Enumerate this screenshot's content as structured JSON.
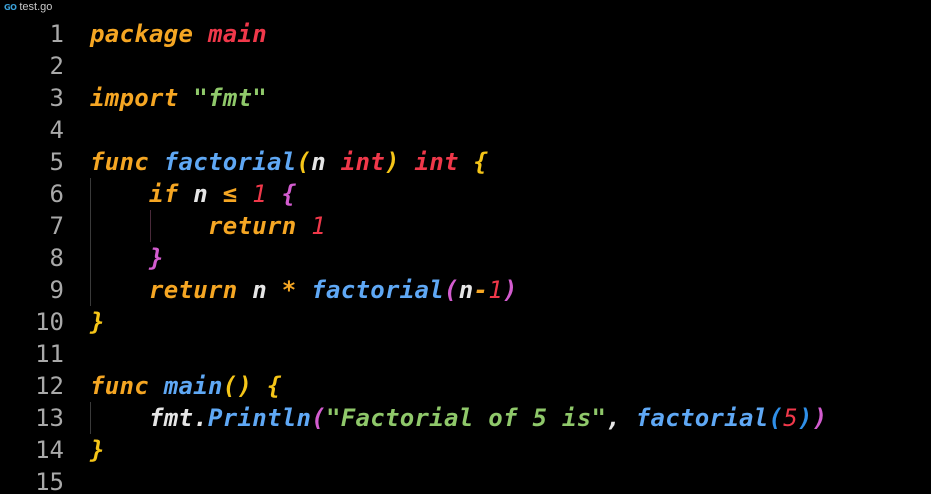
{
  "tab": {
    "filename": "test.go",
    "icon": "go-icon",
    "icon_text": "GO"
  },
  "colors": {
    "background": "#000000",
    "line_number": "#a9a9a9",
    "keyword": "#f5a623",
    "type_and_ident": "#f0384a",
    "string": "#8fc86a",
    "function": "#5fa8f5",
    "bracket_level_1": "#f5c518",
    "bracket_level_2": "#d35ccf",
    "bracket_level_3": "#2f8fe8"
  },
  "lines": [
    {
      "num": "1",
      "tokens": [
        [
          "package",
          "t-kw"
        ],
        [
          " ",
          ""
        ],
        [
          "main",
          "t-red"
        ]
      ]
    },
    {
      "num": "2",
      "tokens": []
    },
    {
      "num": "3",
      "tokens": [
        [
          "import",
          "t-kw"
        ],
        [
          " ",
          ""
        ],
        [
          "\"fmt\"",
          "t-str"
        ]
      ]
    },
    {
      "num": "4",
      "tokens": []
    },
    {
      "num": "5",
      "tokens": [
        [
          "func",
          "t-kw"
        ],
        [
          " ",
          ""
        ],
        [
          "factorial",
          "t-fn"
        ],
        [
          "(",
          "t-b1"
        ],
        [
          "n",
          "t-var"
        ],
        [
          " ",
          ""
        ],
        [
          "int",
          "t-red"
        ],
        [
          ")",
          "t-b1"
        ],
        [
          " ",
          ""
        ],
        [
          "int",
          "t-red"
        ],
        [
          " ",
          ""
        ],
        [
          "{",
          "t-b1"
        ]
      ]
    },
    {
      "num": "6",
      "tokens": [
        [
          "    ",
          ""
        ],
        [
          "if",
          "t-kw"
        ],
        [
          " ",
          ""
        ],
        [
          "n",
          "t-var"
        ],
        [
          " ",
          ""
        ],
        [
          "≤",
          "t-op"
        ],
        [
          " ",
          ""
        ],
        [
          "1",
          "t-num"
        ],
        [
          " ",
          ""
        ],
        [
          "{",
          "t-b2"
        ]
      ]
    },
    {
      "num": "7",
      "tokens": [
        [
          "        ",
          ""
        ],
        [
          "return",
          "t-kw"
        ],
        [
          " ",
          ""
        ],
        [
          "1",
          "t-num"
        ]
      ]
    },
    {
      "num": "8",
      "tokens": [
        [
          "    ",
          ""
        ],
        [
          "}",
          "t-b2"
        ]
      ]
    },
    {
      "num": "9",
      "tokens": [
        [
          "    ",
          ""
        ],
        [
          "return",
          "t-kw"
        ],
        [
          " ",
          ""
        ],
        [
          "n",
          "t-var"
        ],
        [
          " ",
          ""
        ],
        [
          "*",
          "t-op"
        ],
        [
          " ",
          ""
        ],
        [
          "factorial",
          "t-fn"
        ],
        [
          "(",
          "t-b2"
        ],
        [
          "n",
          "t-var"
        ],
        [
          "-",
          "t-op"
        ],
        [
          "1",
          "t-num"
        ],
        [
          ")",
          "t-b2"
        ]
      ]
    },
    {
      "num": "10",
      "tokens": [
        [
          "}",
          "t-b1"
        ]
      ]
    },
    {
      "num": "11",
      "tokens": []
    },
    {
      "num": "12",
      "tokens": [
        [
          "func",
          "t-kw"
        ],
        [
          " ",
          ""
        ],
        [
          "main",
          "t-fn"
        ],
        [
          "()",
          "t-b1"
        ],
        [
          " ",
          ""
        ],
        [
          "{",
          "t-b1"
        ]
      ]
    },
    {
      "num": "13",
      "tokens": [
        [
          "    ",
          ""
        ],
        [
          "fmt",
          "t-var"
        ],
        [
          ".",
          "t-pun"
        ],
        [
          "Println",
          "t-fn"
        ],
        [
          "(",
          "t-b2"
        ],
        [
          "\"Factorial of 5 is\"",
          "t-str"
        ],
        [
          ",",
          "t-pun"
        ],
        [
          " ",
          ""
        ],
        [
          "factorial",
          "t-fn"
        ],
        [
          "(",
          "t-b3"
        ],
        [
          "5",
          "t-num"
        ],
        [
          ")",
          "t-b3"
        ],
        [
          ")",
          "t-b2"
        ]
      ]
    },
    {
      "num": "14",
      "tokens": [
        [
          "}",
          "t-b1"
        ]
      ]
    },
    {
      "num": "15",
      "tokens": []
    }
  ]
}
